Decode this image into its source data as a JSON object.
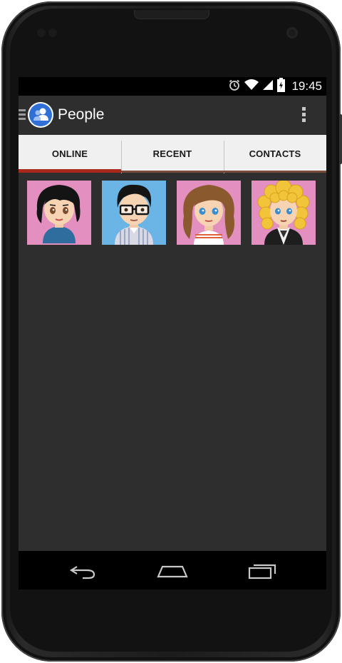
{
  "status_bar": {
    "time": "19:45",
    "icons": [
      "alarm-icon",
      "wifi-icon",
      "signal-icon",
      "battery-charging-icon"
    ]
  },
  "action_bar": {
    "title": "People",
    "icons": [
      "drawer-icon",
      "people-app-icon",
      "overflow-menu-icon"
    ]
  },
  "tabs": [
    {
      "label": "ONLINE",
      "active": true
    },
    {
      "label": "RECENT",
      "active": false
    },
    {
      "label": "CONTACTS",
      "active": false
    }
  ],
  "contacts": [
    {
      "avatar": "woman-dark-hair-avatar",
      "bg": "#e38fc0"
    },
    {
      "avatar": "man-glasses-avatar",
      "bg": "#6ab4e6"
    },
    {
      "avatar": "woman-brown-hair-avatar",
      "bg": "#e38fc0"
    },
    {
      "avatar": "man-blonde-curly-avatar",
      "bg": "#e38fc0"
    }
  ],
  "nav_bar": {
    "icons": [
      "back-icon",
      "home-icon",
      "recent-apps-icon"
    ]
  },
  "colors": {
    "screen_bg": "#2e2e2e",
    "tab_bg": "#f0f0f0",
    "tab_indicator": "#a8281c",
    "app_icon_accent": "#2f6fd6"
  }
}
